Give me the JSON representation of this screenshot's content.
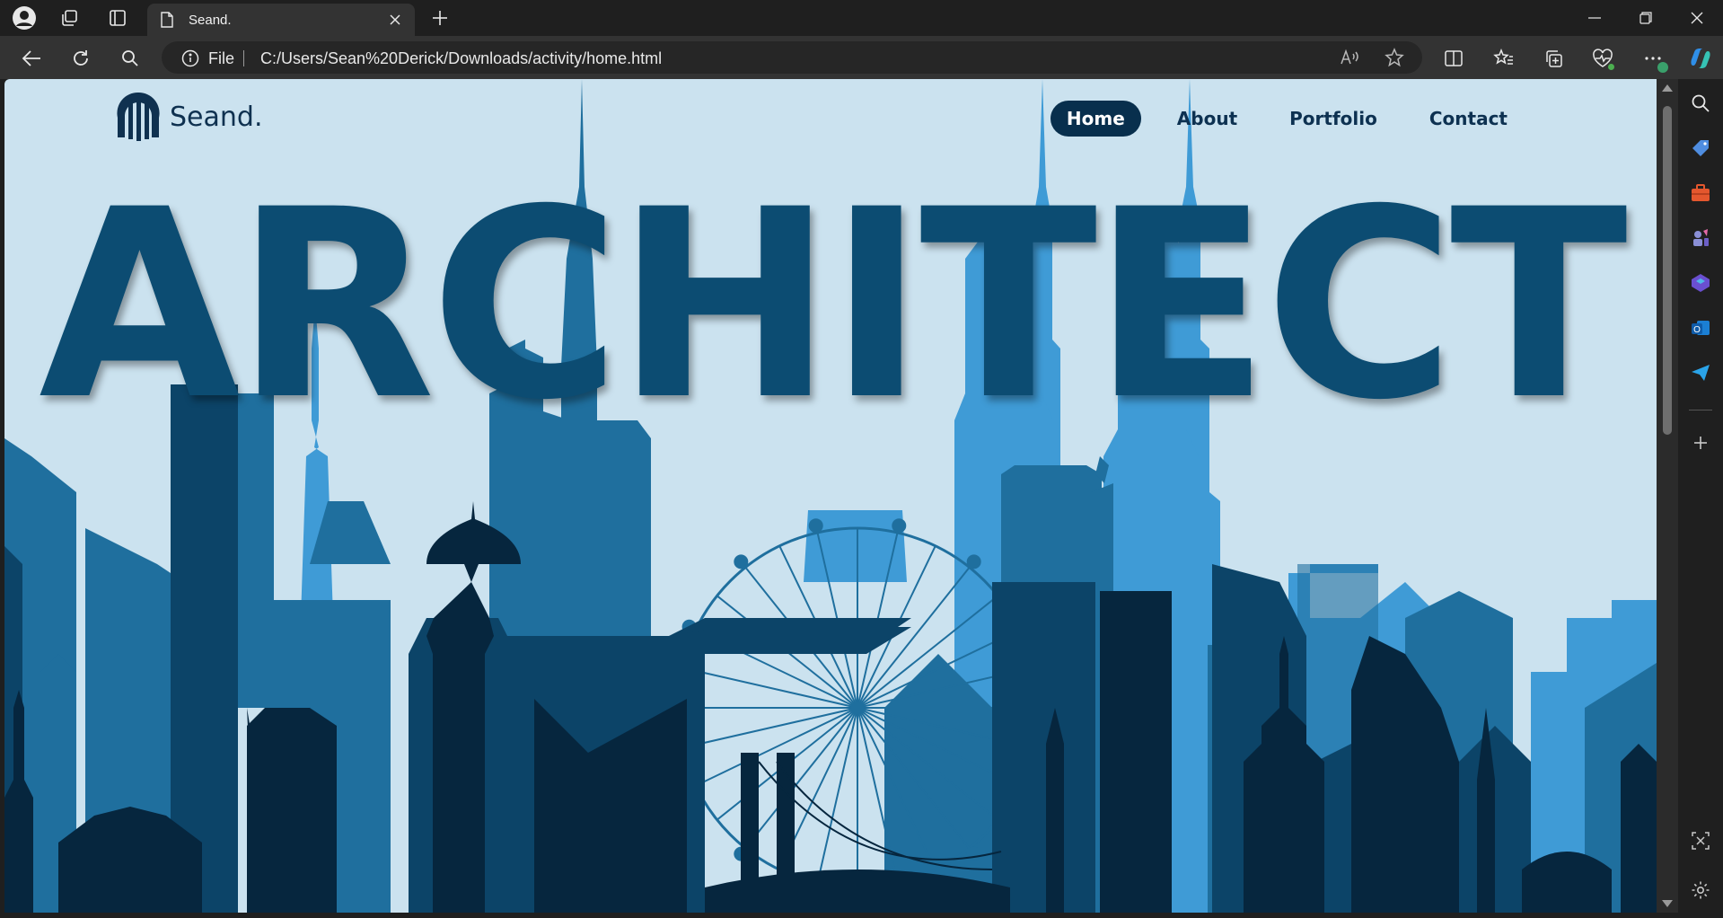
{
  "browser": {
    "tab_title": "Seand.",
    "address_prefix": "File",
    "url": "C:/Users/Sean%20Derick/Downloads/activity/home.html"
  },
  "site": {
    "logo_text": "Seand.",
    "nav": [
      {
        "label": "Home",
        "active": true
      },
      {
        "label": "About",
        "active": false
      },
      {
        "label": "Portfolio",
        "active": false
      },
      {
        "label": "Contact",
        "active": false
      }
    ],
    "hero_title": "ARCHITECT"
  },
  "colors": {
    "sky": "#cbe2ef",
    "hero_text": "#0c4c72",
    "nav_active_bg": "#082f4d",
    "skyline_light": "#3f9bd6",
    "skyline_mid": "#1f6f9e",
    "skyline_dark": "#0c4468",
    "skyline_darkest": "#06263e"
  }
}
